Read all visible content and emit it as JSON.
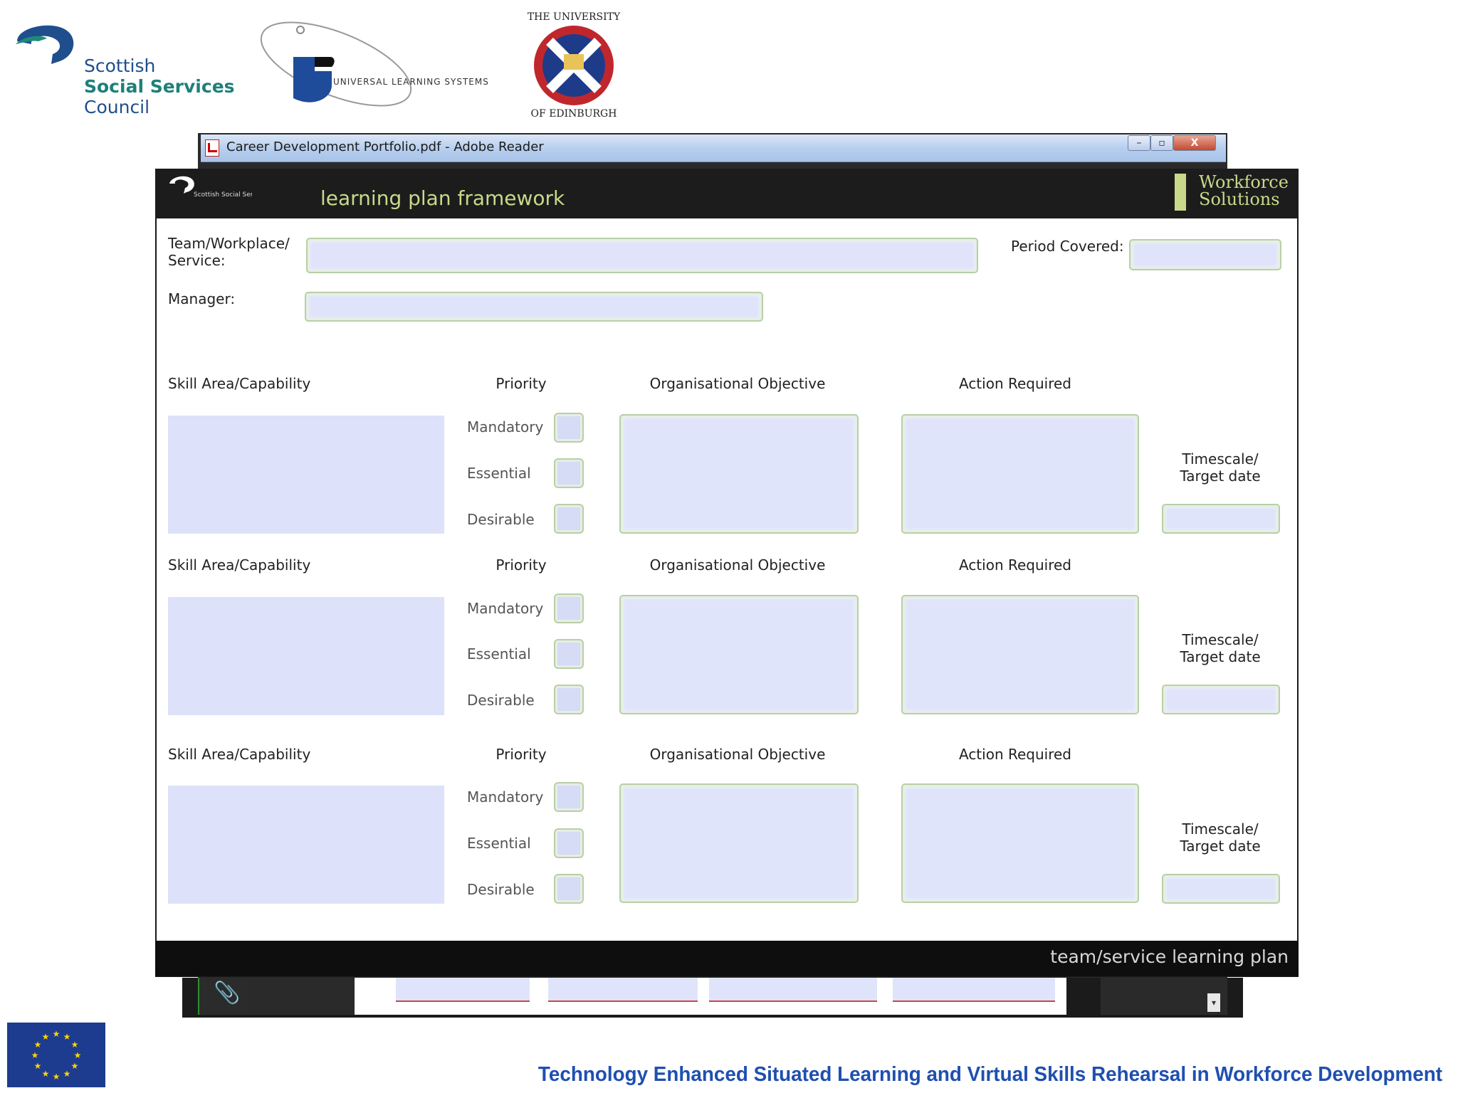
{
  "logos": {
    "sssc": {
      "line1": "Scottish",
      "line2": "Social Services",
      "line3": "Council"
    },
    "uls": {
      "text": "UNIVERSAL LEARNING SYSTEMS"
    },
    "uoe": {
      "ring_text": "THE UNIVERSITY OF EDINBURGH"
    }
  },
  "window": {
    "title": "Career Development Portfolio.pdf - Adobe Reader",
    "buttons": {
      "minimize": "–",
      "maximize": "▫",
      "close": "X"
    }
  },
  "document": {
    "header": {
      "logo_text": "Scottish Social Services Council",
      "title": "learning plan framework",
      "brand_line1": "Workforce",
      "brand_line2": "Solutions"
    },
    "fields": {
      "team_label_1": "Team/Workplace/",
      "team_label_2": "Service:",
      "period_label": "Period Covered:",
      "manager_label": "Manager:"
    },
    "sections": [
      {
        "skill_label": "Skill Area/Capability",
        "priority_label": "Priority",
        "objective_label": "Organisational Objective",
        "action_label": "Action Required",
        "options": [
          "Mandatory",
          "Essential",
          "Desirable"
        ],
        "timescale_1": "Timescale/",
        "timescale_2": "Target date"
      },
      {
        "skill_label": "Skill Area/Capability",
        "priority_label": "Priority",
        "objective_label": "Organisational Objective",
        "action_label": "Action Required",
        "options": [
          "Mandatory",
          "Essential",
          "Desirable"
        ],
        "timescale_1": "Timescale/",
        "timescale_2": "Target date"
      },
      {
        "skill_label": "Skill Area/Capability",
        "priority_label": "Priority",
        "objective_label": "Organisational Objective",
        "action_label": "Action Required",
        "options": [
          "Mandatory",
          "Essential",
          "Desirable"
        ],
        "timescale_1": "Timescale/",
        "timescale_2": "Target date"
      }
    ],
    "footer": "team/service learning plan"
  },
  "toolbar": {
    "attach_icon": "paperclip-icon",
    "scroll_arrow": "▾"
  },
  "tagline": "Technology Enhanced Situated Learning and Virtual Skills Rehearsal in Workforce Development",
  "colors": {
    "header_bg": "#1c1c1c",
    "header_text": "#c8d98a",
    "field_fill": "#dfe4fa",
    "field_border": "#b8cfa8",
    "tagline": "#1f4fb0",
    "eu_blue": "#1d3b8f",
    "eu_stars": "#ffd500"
  }
}
